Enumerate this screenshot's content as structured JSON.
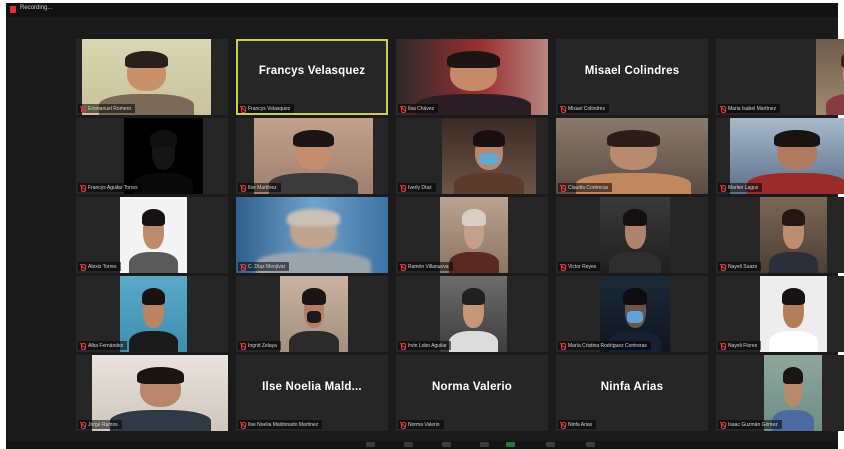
{
  "topbar": {
    "recording_label": "Recording..."
  },
  "tiles": [
    {
      "name": "Emmanuel Romero"
    },
    {
      "name": "Francys Velasquez",
      "big_name": "Francys Velasquez"
    },
    {
      "name": "Ilsa Chávez"
    },
    {
      "name": "Misael Colindres",
      "big_name": "Misael Colindres"
    },
    {
      "name": "Maria Isabel Martínez"
    },
    {
      "name": "Francys Aguilar Torres"
    },
    {
      "name": "Ilse Martínez"
    },
    {
      "name": "Iverly Díaz"
    },
    {
      "name": "Claudia Contreras"
    },
    {
      "name": "Marlen Lagos"
    },
    {
      "name": "Alexis Torres"
    },
    {
      "name": "C. Díaz Menjívar"
    },
    {
      "name": "Ramón Villanueva"
    },
    {
      "name": "Victor Reyes"
    },
    {
      "name": "Nayeli Suazo"
    },
    {
      "name": "Alba Fernández"
    },
    {
      "name": "Ingrid Zelaya"
    },
    {
      "name": "Irvin Lobo Aguilar"
    },
    {
      "name": "María Cristina Rodríguez Contreras"
    },
    {
      "name": "Nayeli Flores"
    },
    {
      "name": "Jorge Ramos"
    },
    {
      "name": "Ilse Noelia Maldonado Martínez",
      "big_name": "Ilse Noelia Mald..."
    },
    {
      "name": "Norma Valerio",
      "big_name": "Norma Valerio"
    },
    {
      "name": "Ninfa Arias",
      "big_name": "Ninfa Arias"
    },
    {
      "name": "Isaac Guzmán Gómez"
    }
  ],
  "colors": {
    "background": "#1a1a1a",
    "tile": "#262626",
    "active_border": "#c9cf52",
    "muted_mic": "#e33b3b"
  }
}
